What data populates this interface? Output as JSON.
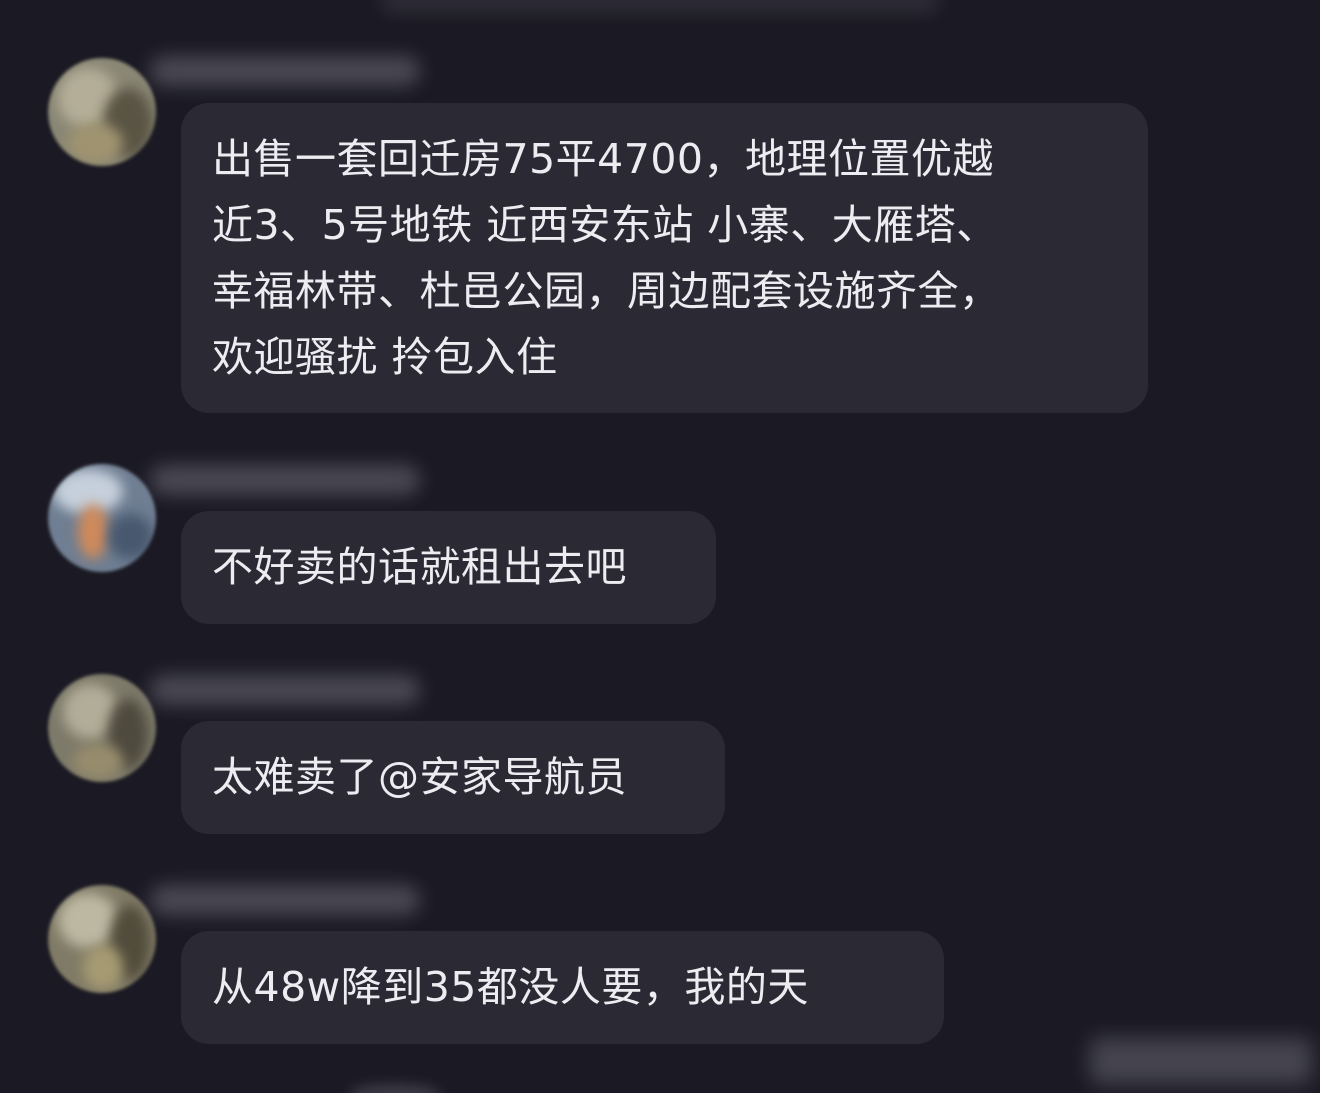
{
  "messages": [
    {
      "lines": [
        "出售一套回迁房75平4700，地理位置优越",
        "近3、5号地铁 近西安东站 小寨、大雁塔、",
        "幸福林带、杜邑公园，周边配套设施齐全，",
        "欢迎骚扰 拎包入住"
      ]
    },
    {
      "lines": [
        "不好卖的话就租出去吧"
      ]
    },
    {
      "lines": [
        "太难卖了@安家导航员"
      ]
    },
    {
      "lines": [
        "从48w降到35都没人要，我的天"
      ]
    }
  ],
  "colors": {
    "background": "#1b1a24",
    "bubble": "#2b2a34",
    "text": "#ececf1"
  },
  "icons": [
    "avatar-photo-forest",
    "avatar-photo-landscape",
    "avatar-photo-forest",
    "avatar-photo-forest"
  ]
}
